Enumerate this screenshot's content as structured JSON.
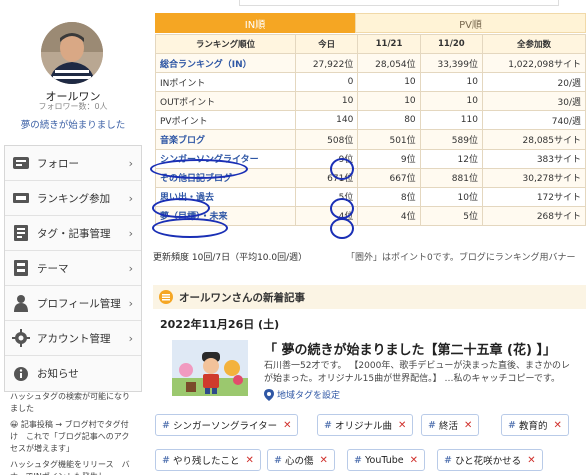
{
  "profile": {
    "name": "オールワン",
    "followers": "フォロワー数：0人",
    "blog_title": "夢の続きが始まりました"
  },
  "menu": [
    {
      "label": "フォロー",
      "icon": "follow-icon"
    },
    {
      "label": "ランキング参加",
      "icon": "ranking-icon"
    },
    {
      "label": "タグ・記事管理",
      "icon": "tag-article-icon"
    },
    {
      "label": "テーマ",
      "icon": "theme-icon"
    },
    {
      "label": "プロフィール管理",
      "icon": "profile-icon"
    },
    {
      "label": "アカウント管理",
      "icon": "gear-icon"
    },
    {
      "label": "お知らせ",
      "icon": "info-icon"
    }
  ],
  "notices": [
    "ハッシュタグの検索が可能になりました",
    "😀 記事投稿 → ブログ村でタグ付け　これで「ブログ記事へのアクセスが増えます」",
    "ハッシュタグ機能をリリース　バナーでINポイントも発生し"
  ],
  "ranking": {
    "tabs": {
      "in": "IN順",
      "pv": "PV順"
    },
    "headers": [
      "ランキング順位",
      "今日",
      "11/21",
      "11/20",
      "全参加数"
    ],
    "rows": [
      {
        "name": "総合ランキング（IN）",
        "link": true,
        "today": "27,922位",
        "d1": "28,054位",
        "d2": "33,399位",
        "total": "1,022,098サイト"
      },
      {
        "name": "INポイント",
        "link": false,
        "today": "0",
        "d1": "10",
        "d2": "10",
        "total": "20/週"
      },
      {
        "name": "OUTポイント",
        "link": false,
        "today": "10",
        "d1": "10",
        "d2": "10",
        "total": "30/週"
      },
      {
        "name": "PVポイント",
        "link": false,
        "today": "140",
        "d1": "80",
        "d2": "110",
        "total": "740/週"
      },
      {
        "name": "音楽ブログ",
        "link": true,
        "today": "508位",
        "d1": "501位",
        "d2": "589位",
        "total": "28,085サイト"
      },
      {
        "name": "シンガーソングライター",
        "link": true,
        "today": "9位",
        "d1": "9位",
        "d2": "12位",
        "total": "383サイト"
      },
      {
        "name": "その他日記ブログ",
        "link": true,
        "today": "671位",
        "d1": "667位",
        "d2": "881位",
        "total": "30,278サイト"
      },
      {
        "name": "思い出・過去",
        "link": true,
        "today": "5位",
        "d1": "8位",
        "d2": "10位",
        "total": "172サイト"
      },
      {
        "name": "夢（目標）・未来",
        "link": true,
        "today": "4位",
        "d1": "4位",
        "d2": "5位",
        "total": "268サイト"
      }
    ],
    "frequency": "更新頻度 10回/7日（平均10.0回/週）",
    "note": "「圏外」はポイント0です。ブログにランキング用バナー"
  },
  "feed": {
    "heading": "オールワンさんの新着記事",
    "date": "2022年11月26日 (土)",
    "article_title": "「 夢の続きが始まりました【第二十五章 (花) 】」",
    "article_line1": "石川善一52才です。 【2000年、歌手デビューが決まった直後、まさかのレ",
    "article_line2": "が始まった。オリジナル15曲が世界配信。】 …私のキャッチコピーです。",
    "region_link": "地域タグを設定"
  },
  "tags": [
    "シンガーソングライター",
    "オリジナル曲",
    "終活",
    "教育的",
    "やり残したこと",
    "心の傷",
    "YouTube",
    "ひと花咲かせる"
  ],
  "colors": {
    "accent": "#f5a623",
    "link": "#2f57a5",
    "annotation": "#1a2fb5"
  }
}
